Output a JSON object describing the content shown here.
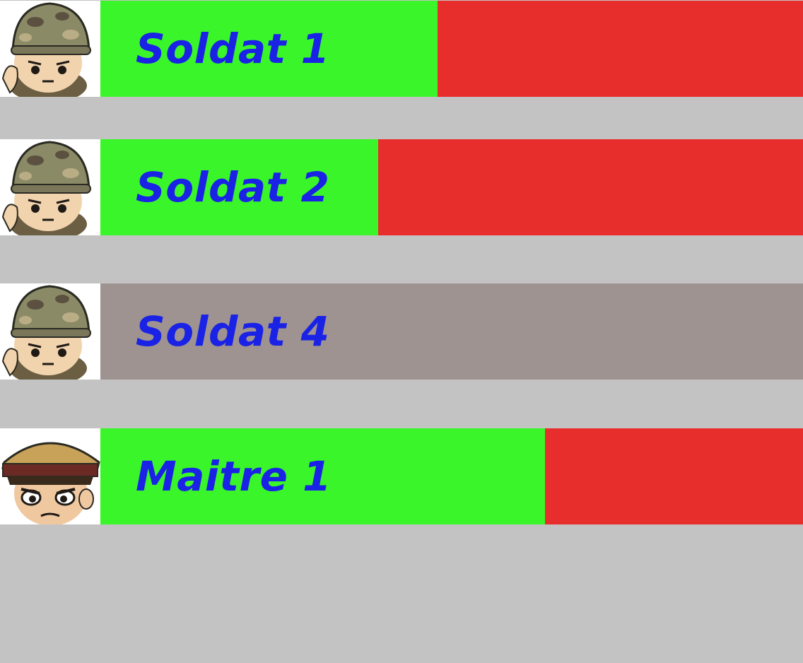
{
  "colors": {
    "background": "#c4c3c3",
    "health": "#39f52a",
    "damage": "#e82d2d",
    "dead": "#9e9391",
    "name_text": "#1a22e6"
  },
  "units": [
    {
      "name": "Soldat 1",
      "avatar_icon": "soldier-icon",
      "health_fraction": 0.48,
      "status": "alive"
    },
    {
      "name": "Soldat 2",
      "avatar_icon": "soldier-icon",
      "health_fraction": 0.395,
      "status": "alive"
    },
    {
      "name": "Soldat 4",
      "avatar_icon": "soldier-icon",
      "health_fraction": 0.0,
      "status": "dead"
    },
    {
      "name": "Maitre 1",
      "avatar_icon": "officer-icon",
      "health_fraction": 0.633,
      "status": "alive"
    }
  ]
}
